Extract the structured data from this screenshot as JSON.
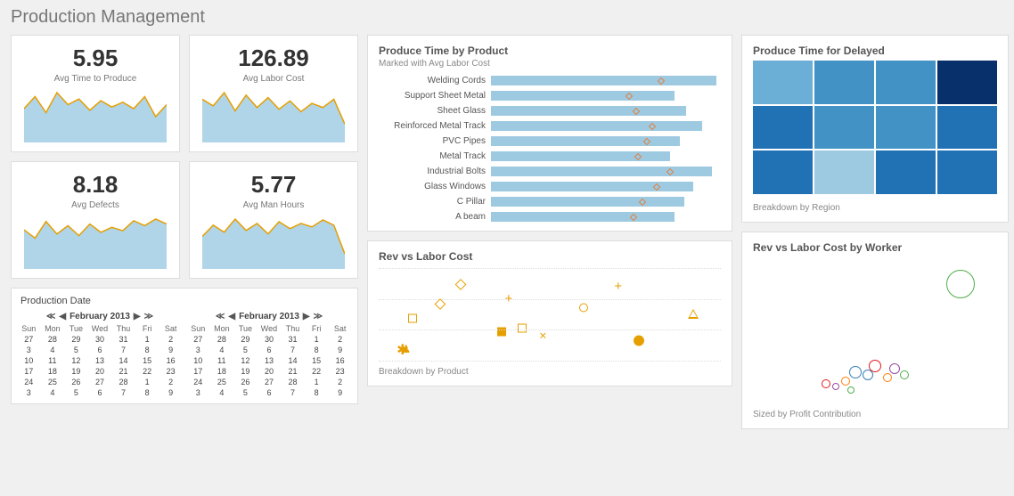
{
  "title": "Production Management",
  "kpis": {
    "time_to_produce": {
      "value": "5.95",
      "label": "Avg Time to Produce",
      "spark": [
        40,
        55,
        35,
        60,
        45,
        52,
        38,
        50,
        42,
        48,
        40,
        55,
        30,
        45
      ]
    },
    "labor_cost": {
      "value": "126.89",
      "label": "Avg Labor Cost",
      "spark": [
        50,
        42,
        58,
        36,
        55,
        40,
        52,
        38,
        48,
        35,
        45,
        40,
        50,
        20
      ]
    },
    "defects": {
      "value": "8.18",
      "label": "Avg Defects",
      "spark": [
        45,
        35,
        55,
        40,
        50,
        38,
        52,
        42,
        48,
        44,
        56,
        50,
        58,
        52
      ]
    },
    "man_hours": {
      "value": "5.77",
      "label": "Avg Man Hours",
      "spark": [
        35,
        48,
        40,
        55,
        42,
        50,
        38,
        52,
        44,
        50,
        46,
        54,
        48,
        15
      ]
    }
  },
  "produce_by_product": {
    "title": "Produce Time by Product",
    "subtitle": "Marked with Avg Labor Cost",
    "rows": [
      {
        "label": "Welding Cords",
        "value": 98,
        "mark": 74
      },
      {
        "label": "Support Sheet Metal",
        "value": 80,
        "mark": 60
      },
      {
        "label": "Sheet Glass",
        "value": 85,
        "mark": 63
      },
      {
        "label": "Reinforced Metal Track",
        "value": 92,
        "mark": 70
      },
      {
        "label": "PVC Pipes",
        "value": 82,
        "mark": 68
      },
      {
        "label": "Metal Track",
        "value": 78,
        "mark": 64
      },
      {
        "label": "Industrial Bolts",
        "value": 96,
        "mark": 78
      },
      {
        "label": "Glass Windows",
        "value": 88,
        "mark": 72
      },
      {
        "label": "C Pillar",
        "value": 84,
        "mark": 66
      },
      {
        "label": "A beam",
        "value": 80,
        "mark": 62
      }
    ]
  },
  "rev_vs_labor": {
    "title": "Rev vs Labor Cost",
    "footnote": "Breakdown by Product",
    "points": [
      {
        "x": 10,
        "y": 55,
        "shape": "square-open"
      },
      {
        "x": 7,
        "y": 90,
        "shape": "asterisk"
      },
      {
        "x": 8,
        "y": 88,
        "shape": "trophy"
      },
      {
        "x": 18,
        "y": 40,
        "shape": "diamond-open"
      },
      {
        "x": 24,
        "y": 18,
        "shape": "diamond-open"
      },
      {
        "x": 36,
        "y": 70,
        "shape": "square"
      },
      {
        "x": 38,
        "y": 34,
        "shape": "plus"
      },
      {
        "x": 42,
        "y": 66,
        "shape": "square-open"
      },
      {
        "x": 48,
        "y": 74,
        "shape": "cross"
      },
      {
        "x": 60,
        "y": 44,
        "shape": "circle-open"
      },
      {
        "x": 70,
        "y": 20,
        "shape": "plus"
      },
      {
        "x": 76,
        "y": 80,
        "shape": "circle"
      },
      {
        "x": 92,
        "y": 50,
        "shape": "triangle-open"
      }
    ]
  },
  "produce_delayed": {
    "title": "Produce Time for Delayed",
    "footnote": "Breakdown by Region",
    "cells": [
      "#6baed6",
      "#4292c6",
      "#4292c6",
      "#08306b",
      "#2171b5",
      "#4292c6",
      "#4292c6",
      "#2171b5",
      "#2171b5",
      "#9ecae1",
      "#2171b5",
      "#2171b5"
    ]
  },
  "rev_vs_labor_worker": {
    "title": "Rev vs Labor Cost by Worker",
    "footnote": "Sized by Profit Contribution",
    "bubbles": [
      {
        "x": 85,
        "y": 18,
        "r": 16,
        "color": "#4daf4a"
      },
      {
        "x": 30,
        "y": 86,
        "r": 5,
        "color": "#e41a1c"
      },
      {
        "x": 34,
        "y": 88,
        "r": 4,
        "color": "#984ea3"
      },
      {
        "x": 38,
        "y": 84,
        "r": 5,
        "color": "#ff7f00"
      },
      {
        "x": 42,
        "y": 78,
        "r": 7,
        "color": "#377eb8"
      },
      {
        "x": 40,
        "y": 90,
        "r": 4,
        "color": "#4daf4a"
      },
      {
        "x": 47,
        "y": 80,
        "r": 6,
        "color": "#377eb8"
      },
      {
        "x": 50,
        "y": 74,
        "r": 7,
        "color": "#e41a1c"
      },
      {
        "x": 55,
        "y": 82,
        "r": 5,
        "color": "#ff7f00"
      },
      {
        "x": 58,
        "y": 76,
        "r": 6,
        "color": "#984ea3"
      },
      {
        "x": 62,
        "y": 80,
        "r": 5,
        "color": "#4daf4a"
      }
    ]
  },
  "calendar": {
    "header": "Production Date",
    "month_label": "February 2013",
    "days": [
      "Sun",
      "Mon",
      "Tue",
      "Wed",
      "Thu",
      "Fri",
      "Sat"
    ],
    "weeks": [
      [
        "27",
        "28",
        "29",
        "30",
        "31",
        "1",
        "2"
      ],
      [
        "3",
        "4",
        "5",
        "6",
        "7",
        "8",
        "9"
      ],
      [
        "10",
        "11",
        "12",
        "13",
        "14",
        "15",
        "16"
      ],
      [
        "17",
        "18",
        "19",
        "20",
        "21",
        "22",
        "23"
      ],
      [
        "24",
        "25",
        "26",
        "27",
        "28",
        "1",
        "2"
      ],
      [
        "3",
        "4",
        "5",
        "6",
        "7",
        "8",
        "9"
      ]
    ]
  },
  "chart_data": [
    {
      "type": "line",
      "title": "Avg Time to Produce",
      "values": [
        40,
        55,
        35,
        60,
        45,
        52,
        38,
        50,
        42,
        48,
        40,
        55,
        30,
        45
      ],
      "summary_value": 5.95
    },
    {
      "type": "line",
      "title": "Avg Labor Cost",
      "values": [
        50,
        42,
        58,
        36,
        55,
        40,
        52,
        38,
        48,
        35,
        45,
        40,
        50,
        20
      ],
      "summary_value": 126.89
    },
    {
      "type": "line",
      "title": "Avg Defects",
      "values": [
        45,
        35,
        55,
        40,
        50,
        38,
        52,
        42,
        48,
        44,
        56,
        50,
        58,
        52
      ],
      "summary_value": 8.18
    },
    {
      "type": "line",
      "title": "Avg Man Hours",
      "values": [
        35,
        48,
        40,
        55,
        42,
        50,
        38,
        52,
        44,
        50,
        46,
        54,
        48,
        15
      ],
      "summary_value": 5.77
    },
    {
      "type": "bar",
      "title": "Produce Time by Product",
      "categories": [
        "Welding Cords",
        "Support Sheet Metal",
        "Sheet Glass",
        "Reinforced Metal Track",
        "PVC Pipes",
        "Metal Track",
        "Industrial Bolts",
        "Glass Windows",
        "C Pillar",
        "A beam"
      ],
      "values": [
        98,
        80,
        85,
        92,
        82,
        78,
        96,
        88,
        84,
        80
      ],
      "overlay_series": {
        "name": "Avg Labor Cost",
        "values": [
          74,
          60,
          63,
          70,
          68,
          64,
          78,
          72,
          66,
          62
        ]
      }
    },
    {
      "type": "heatmap",
      "title": "Produce Time for Delayed",
      "rows": 3,
      "cols": 4,
      "cell_intensity": [
        "#6baed6",
        "#4292c6",
        "#4292c6",
        "#08306b",
        "#2171b5",
        "#4292c6",
        "#4292c6",
        "#2171b5",
        "#2171b5",
        "#9ecae1",
        "#2171b5",
        "#2171b5"
      ]
    },
    {
      "type": "scatter",
      "title": "Rev vs Labor Cost",
      "points": [
        [
          10,
          45
        ],
        [
          7,
          10
        ],
        [
          8,
          12
        ],
        [
          18,
          60
        ],
        [
          24,
          82
        ],
        [
          36,
          30
        ],
        [
          38,
          66
        ],
        [
          42,
          34
        ],
        [
          48,
          26
        ],
        [
          60,
          56
        ],
        [
          70,
          80
        ],
        [
          76,
          20
        ],
        [
          92,
          50
        ]
      ]
    },
    {
      "type": "scatter",
      "title": "Rev vs Labor Cost by Worker",
      "points": [
        [
          85,
          82,
          16
        ],
        [
          30,
          14,
          5
        ],
        [
          34,
          12,
          4
        ],
        [
          38,
          16,
          5
        ],
        [
          42,
          22,
          7
        ],
        [
          40,
          10,
          4
        ],
        [
          47,
          20,
          6
        ],
        [
          50,
          26,
          7
        ],
        [
          55,
          18,
          5
        ],
        [
          58,
          24,
          6
        ],
        [
          62,
          20,
          5
        ]
      ],
      "point_encoding": "x,y,radius"
    }
  ]
}
